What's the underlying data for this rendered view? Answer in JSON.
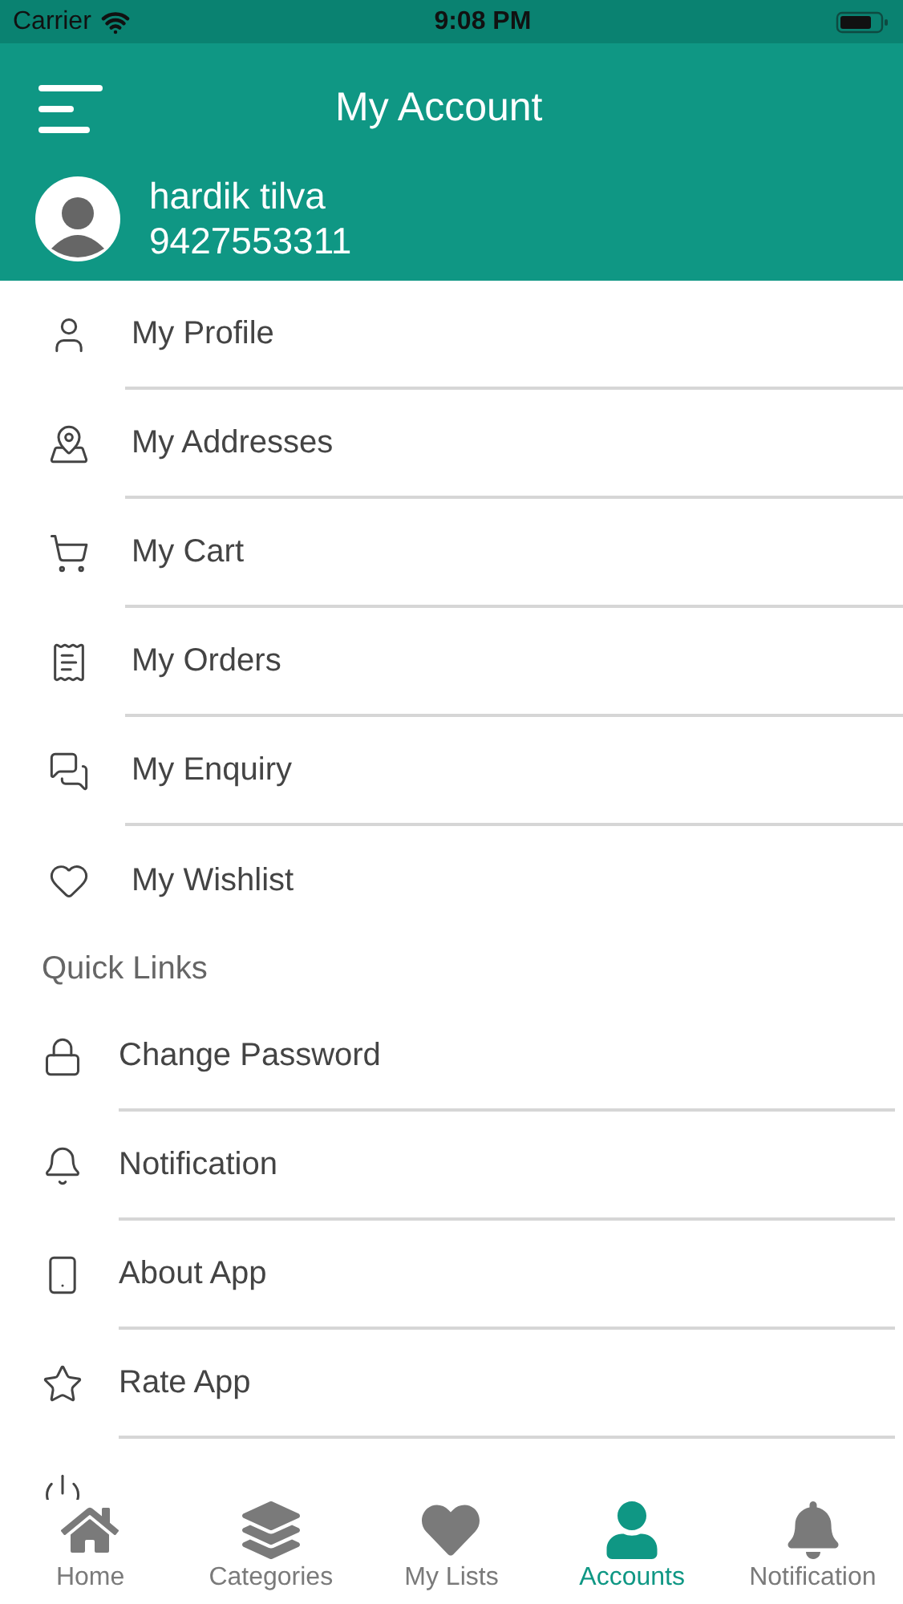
{
  "status_bar": {
    "carrier": "Carrier",
    "time": "9:08 PM"
  },
  "header": {
    "title": "My Account",
    "user_name": "hardik tilva",
    "phone": "9427553311"
  },
  "account_menu": [
    {
      "kind": "profile",
      "label": "My Profile"
    },
    {
      "kind": "addresses",
      "label": "My Addresses"
    },
    {
      "kind": "cart",
      "label": "My Cart"
    },
    {
      "kind": "orders",
      "label": "My Orders"
    },
    {
      "kind": "enquiry",
      "label": "My Enquiry"
    },
    {
      "kind": "wishlist",
      "label": "My Wishlist"
    }
  ],
  "quick_links": {
    "title": "Quick Links",
    "items": [
      {
        "kind": "password",
        "label": "Change Password"
      },
      {
        "kind": "notification",
        "label": "Notification"
      },
      {
        "kind": "about",
        "label": "About App"
      },
      {
        "kind": "rate",
        "label": "Rate App"
      },
      {
        "kind": "logout"
      }
    ]
  },
  "tab_bar": [
    {
      "kind": "home",
      "label": "Home",
      "selected": false
    },
    {
      "kind": "categories",
      "label": "Categories",
      "selected": false
    },
    {
      "kind": "lists",
      "label": "My Lists",
      "selected": false
    },
    {
      "kind": "accounts",
      "label": "Accounts",
      "selected": true
    },
    {
      "kind": "notification",
      "label": "Notification",
      "selected": false
    }
  ]
}
